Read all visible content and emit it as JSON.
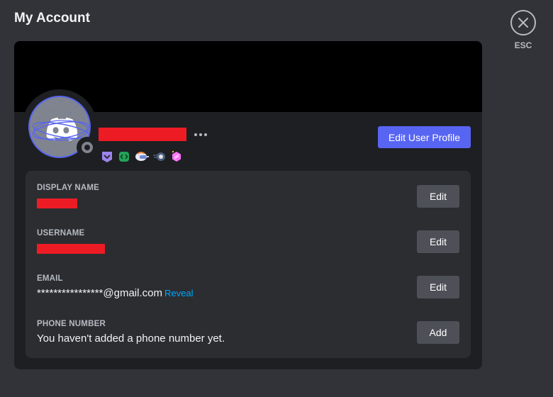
{
  "page": {
    "title": "My Account",
    "close_label": "ESC"
  },
  "profile": {
    "username_redacted": true,
    "more_options_label": "More options",
    "edit_profile_label": "Edit User Profile",
    "avatar_icon": "discord-logo-icon",
    "avatar_ring_color": "#5865f2",
    "status": "offline",
    "badges": [
      {
        "name": "hypesquad-badge-icon",
        "color": "#9c84ef"
      },
      {
        "name": "active-developer-badge-icon",
        "color": "#23a55a"
      },
      {
        "name": "quest-helmet-badge-icon",
        "color": "#e8eaf0"
      },
      {
        "name": "orb-badge-icon",
        "color": "#4e5d78"
      },
      {
        "name": "nitro-boost-badge-icon",
        "color": "#ff73fa"
      }
    ]
  },
  "fields": [
    {
      "label": "DISPLAY NAME",
      "value": "",
      "redacted": true,
      "button": "Edit"
    },
    {
      "label": "USERNAME",
      "value": "",
      "redacted": true,
      "button": "Edit"
    },
    {
      "label": "EMAIL",
      "value": "****************@gmail.com",
      "link": "Reveal",
      "button": "Edit"
    },
    {
      "label": "PHONE NUMBER",
      "value": "You haven't added a phone number yet.",
      "button": "Add"
    }
  ],
  "colors": {
    "accent": "#5865f2",
    "link": "#00a8fc",
    "redaction": "#ed1c24",
    "background": "#313338",
    "card": "#1e1f22",
    "panel": "#2b2d31",
    "secondary_button": "#4e5058"
  }
}
